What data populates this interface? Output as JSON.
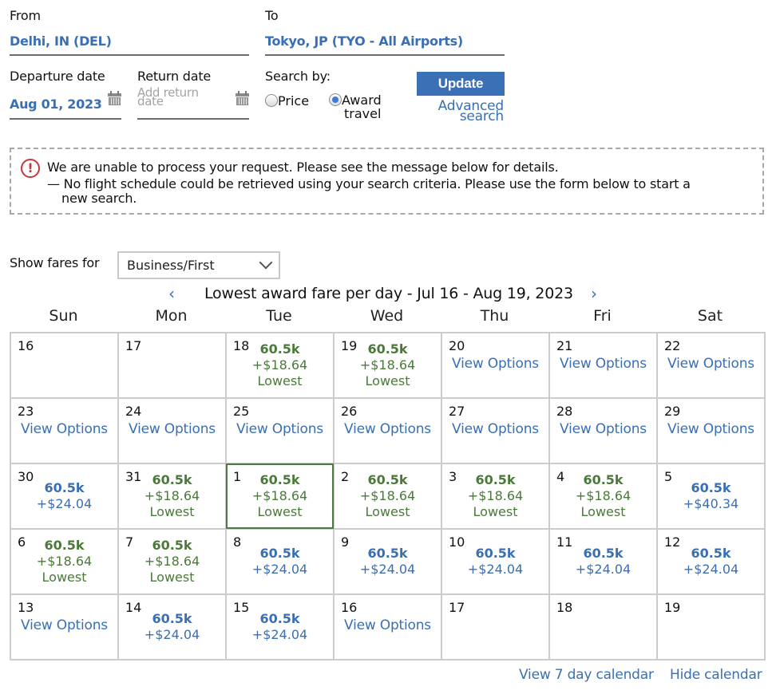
{
  "search_form": {
    "from": {
      "label": "From",
      "value": "Delhi, IN (DEL)"
    },
    "to": {
      "label": "To",
      "value": "Tokyo, JP (TYO - All Airports)"
    },
    "departure": {
      "label": "Departure date",
      "value": "Aug 01, 2023",
      "icon": "calendar-icon"
    },
    "return": {
      "label": "Return date",
      "placeholder_line1": "Add return",
      "placeholder_line2": "date",
      "icon": "calendar-icon"
    },
    "search_by": {
      "label": "Search by:",
      "options": [
        {
          "label": "Price",
          "selected": false
        },
        {
          "label_line1": "Award",
          "label_line2": "travel",
          "selected": true
        }
      ]
    },
    "update_button": "Update",
    "advanced_search_line1": "Advanced",
    "advanced_search_line2": "search"
  },
  "alert": {
    "icon": "exclamation-circle-icon",
    "color": "#c8353c",
    "message": "We are unable to process your request. Please see the message below for details.",
    "detail_line1": "— No flight schedule could be retrieved using your search criteria. Please use the form below to start a",
    "detail_line2": "new search."
  },
  "fares_filter": {
    "label": "Show fares for",
    "selected": "Business/First"
  },
  "calendar": {
    "title": "Lowest award fare per day - Jul 16 - Aug 19, 2023",
    "prev_icon": "‹",
    "next_icon": "›",
    "weekdays": [
      "Sun",
      "Mon",
      "Tue",
      "Wed",
      "Thu",
      "Fri",
      "Sat"
    ],
    "colors": {
      "lowest": "#4a7a3a",
      "regular": "#3a6fb4",
      "selected_border": "#4e7a43"
    },
    "weeks": [
      [
        {
          "day": "16",
          "type": "empty"
        },
        {
          "day": "17",
          "type": "empty"
        },
        {
          "day": "18",
          "type": "lowest",
          "points": "60.5k",
          "tax": "+$18.64",
          "tag": "Lowest"
        },
        {
          "day": "19",
          "type": "lowest",
          "points": "60.5k",
          "tax": "+$18.64",
          "tag": "Lowest"
        },
        {
          "day": "20",
          "type": "options",
          "link": "View Options"
        },
        {
          "day": "21",
          "type": "options",
          "link": "View Options"
        },
        {
          "day": "22",
          "type": "options",
          "link": "View Options"
        }
      ],
      [
        {
          "day": "23",
          "type": "options",
          "link": "View Options"
        },
        {
          "day": "24",
          "type": "options",
          "link": "View Options"
        },
        {
          "day": "25",
          "type": "options",
          "link": "View Options"
        },
        {
          "day": "26",
          "type": "options",
          "link": "View Options"
        },
        {
          "day": "27",
          "type": "options",
          "link": "View Options"
        },
        {
          "day": "28",
          "type": "options",
          "link": "View Options"
        },
        {
          "day": "29",
          "type": "options",
          "link": "View Options"
        }
      ],
      [
        {
          "day": "30",
          "type": "regular",
          "points": "60.5k",
          "tax": "+$24.04"
        },
        {
          "day": "31",
          "type": "lowest",
          "points": "60.5k",
          "tax": "+$18.64",
          "tag": "Lowest"
        },
        {
          "day": "1",
          "type": "lowest",
          "points": "60.5k",
          "tax": "+$18.64",
          "tag": "Lowest",
          "selected": true
        },
        {
          "day": "2",
          "type": "lowest",
          "points": "60.5k",
          "tax": "+$18.64",
          "tag": "Lowest"
        },
        {
          "day": "3",
          "type": "lowest",
          "points": "60.5k",
          "tax": "+$18.64",
          "tag": "Lowest"
        },
        {
          "day": "4",
          "type": "lowest",
          "points": "60.5k",
          "tax": "+$18.64",
          "tag": "Lowest"
        },
        {
          "day": "5",
          "type": "regular",
          "points": "60.5k",
          "tax": "+$40.34"
        }
      ],
      [
        {
          "day": "6",
          "type": "lowest",
          "points": "60.5k",
          "tax": "+$18.64",
          "tag": "Lowest"
        },
        {
          "day": "7",
          "type": "lowest",
          "points": "60.5k",
          "tax": "+$18.64",
          "tag": "Lowest"
        },
        {
          "day": "8",
          "type": "regular",
          "points": "60.5k",
          "tax": "+$24.04"
        },
        {
          "day": "9",
          "type": "regular",
          "points": "60.5k",
          "tax": "+$24.04"
        },
        {
          "day": "10",
          "type": "regular",
          "points": "60.5k",
          "tax": "+$24.04"
        },
        {
          "day": "11",
          "type": "regular",
          "points": "60.5k",
          "tax": "+$24.04"
        },
        {
          "day": "12",
          "type": "regular",
          "points": "60.5k",
          "tax": "+$24.04"
        }
      ],
      [
        {
          "day": "13",
          "type": "options",
          "link": "View Options"
        },
        {
          "day": "14",
          "type": "regular",
          "points": "60.5k",
          "tax": "+$24.04"
        },
        {
          "day": "15",
          "type": "regular",
          "points": "60.5k",
          "tax": "+$24.04"
        },
        {
          "day": "16",
          "type": "options",
          "link": "View Options"
        },
        {
          "day": "17",
          "type": "empty"
        },
        {
          "day": "18",
          "type": "empty"
        },
        {
          "day": "19",
          "type": "empty"
        }
      ]
    ]
  },
  "footer": {
    "view_7_day": "View 7 day calendar",
    "hide_calendar": "Hide calendar"
  }
}
